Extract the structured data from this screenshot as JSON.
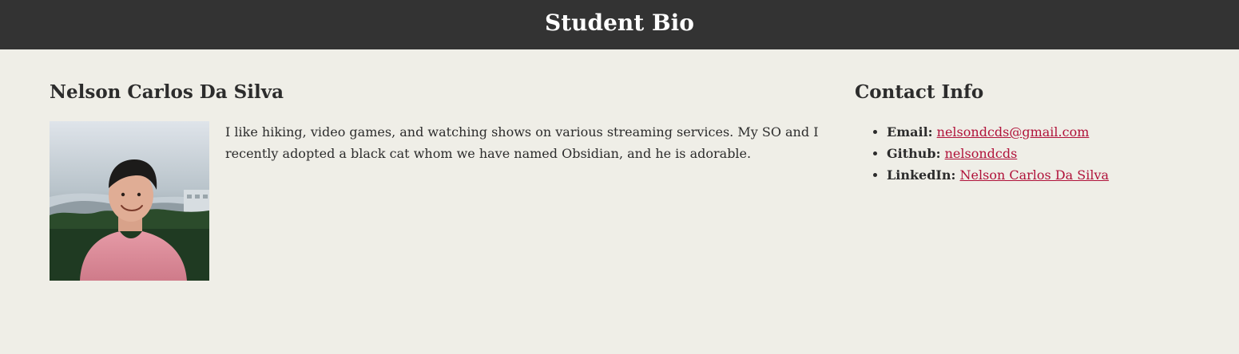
{
  "header": {
    "title": "Student Bio"
  },
  "profile": {
    "name": "Nelson Carlos Da Silva",
    "bio": "I like hiking, video games, and watching shows on various streaming services. My SO and I recently adopted a black cat whom we have named Obsidian, and he is adorable."
  },
  "contact": {
    "title": "Contact Info",
    "items": [
      {
        "label": "Email:",
        "value": "nelsondcds@gmail.com"
      },
      {
        "label": "Github:",
        "value": "nelsondcds"
      },
      {
        "label": "LinkedIn:",
        "value": "Nelson Carlos Da Silva"
      }
    ]
  },
  "colors": {
    "header_bg": "#333333",
    "page_bg": "#efeee7",
    "link": "#b0123a"
  }
}
